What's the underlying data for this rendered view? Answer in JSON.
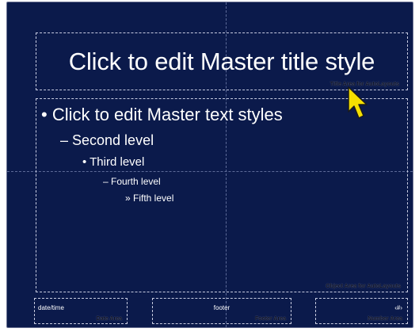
{
  "slide": {
    "title": "Click to edit Master title style",
    "title_area_label": "Title Area for AutoLayouts",
    "body_levels": [
      "• Click to edit Master text styles",
      "– Second level",
      "• Third level",
      "– Fourth level",
      "» Fifth level"
    ],
    "body_area_label": "Object Area for AutoLayouts",
    "footer": {
      "date_text": "date/time",
      "date_label": "Date Area",
      "footer_text": "footer",
      "footer_label": "Footer Area",
      "number_text": "‹#›",
      "number_label": "Number Area"
    }
  },
  "colors": {
    "background": "#0b1a4b",
    "text": "#ffffff",
    "cursor": "#f5e000"
  },
  "icons": {
    "cursor": "arrow-pointer-icon"
  }
}
